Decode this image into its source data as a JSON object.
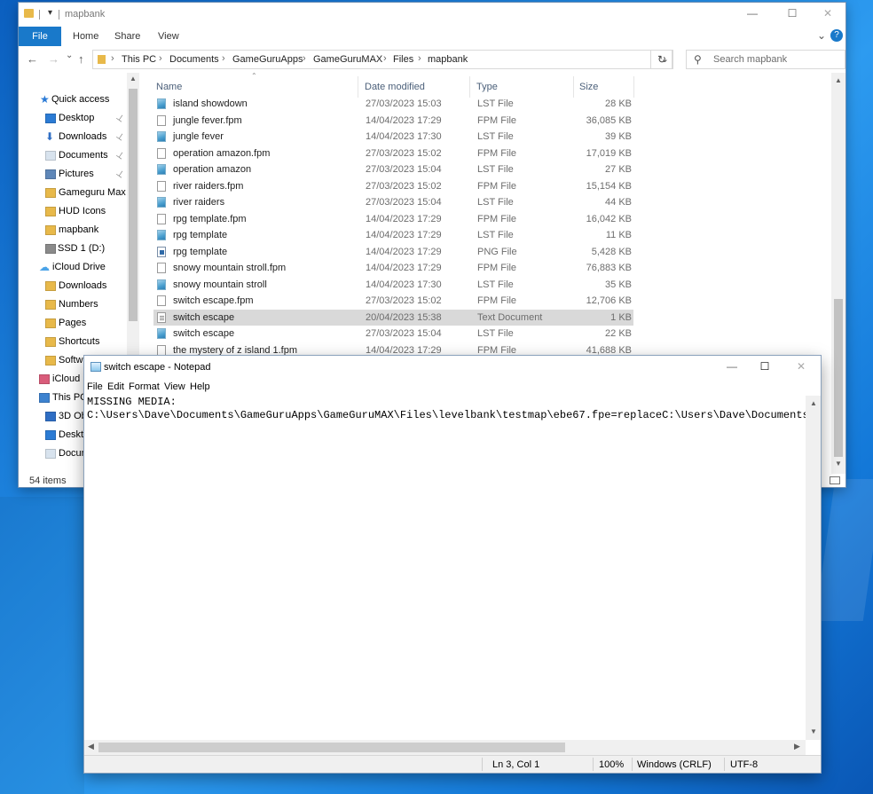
{
  "explorer": {
    "title": "mapbank",
    "window_controls": {
      "minimize": "—",
      "maximize": "☐",
      "close": "✕"
    },
    "ribbon": {
      "file": "File",
      "tabs": [
        "Home",
        "Share",
        "View"
      ],
      "help": "?"
    },
    "nav_buttons": {
      "back": "←",
      "forward": "→",
      "recent": "⌄",
      "up": "↑"
    },
    "breadcrumb": [
      "This PC",
      "Documents",
      "GameGuruApps",
      "GameGuruMAX",
      "Files",
      "mapbank"
    ],
    "search_placeholder": "Search mapbank",
    "columns": {
      "name": "Name",
      "date": "Date modified",
      "type": "Type",
      "size": "Size"
    },
    "nav_items": [
      {
        "label": "Quick access",
        "icon": "star-icon",
        "pinned": false
      },
      {
        "label": "Desktop",
        "icon": "desktop-icon",
        "pinned": true
      },
      {
        "label": "Downloads",
        "icon": "download-icon",
        "pinned": true
      },
      {
        "label": "Documents",
        "icon": "documents-icon",
        "pinned": true
      },
      {
        "label": "Pictures",
        "icon": "pictures-icon",
        "pinned": true
      },
      {
        "label": "Gameguru Max",
        "icon": "folder-icon",
        "pinned": false
      },
      {
        "label": "HUD Icons",
        "icon": "folder-icon",
        "pinned": false
      },
      {
        "label": "mapbank",
        "icon": "folder-icon",
        "pinned": false
      },
      {
        "label": "SSD 1 (D:)",
        "icon": "drive-icon",
        "pinned": false
      },
      {
        "label": "iCloud Drive",
        "icon": "cloud-icon",
        "pinned": false
      },
      {
        "label": "Downloads",
        "icon": "folder-icon",
        "pinned": false
      },
      {
        "label": "Numbers",
        "icon": "folder-icon",
        "pinned": false
      },
      {
        "label": "Pages",
        "icon": "folder-icon",
        "pinned": false
      },
      {
        "label": "Shortcuts",
        "icon": "folder-icon",
        "pinned": false
      },
      {
        "label": "Softwa",
        "icon": "folder-icon",
        "pinned": false
      },
      {
        "label": "iCloud P",
        "icon": "photos-icon",
        "pinned": false
      },
      {
        "label": "This PC",
        "icon": "computer-icon",
        "pinned": false
      },
      {
        "label": "3D Ob",
        "icon": "3d-objects-icon",
        "pinned": false
      },
      {
        "label": "Deskto",
        "icon": "desktop-icon",
        "pinned": false
      },
      {
        "label": "Docun",
        "icon": "documents-icon",
        "pinned": false
      }
    ],
    "pin_glyph": "📌",
    "files": [
      {
        "name": "island showdown",
        "date": "27/03/2023 15:03",
        "type": "LST File",
        "size": "28 KB",
        "icon": "lst"
      },
      {
        "name": "jungle fever.fpm",
        "date": "14/04/2023 17:29",
        "type": "FPM File",
        "size": "36,085 KB",
        "icon": "fpm"
      },
      {
        "name": "jungle fever",
        "date": "14/04/2023 17:30",
        "type": "LST File",
        "size": "39 KB",
        "icon": "lst"
      },
      {
        "name": "operation amazon.fpm",
        "date": "27/03/2023 15:02",
        "type": "FPM File",
        "size": "17,019 KB",
        "icon": "fpm"
      },
      {
        "name": "operation amazon",
        "date": "27/03/2023 15:04",
        "type": "LST File",
        "size": "27 KB",
        "icon": "lst"
      },
      {
        "name": "river raiders.fpm",
        "date": "27/03/2023 15:02",
        "type": "FPM File",
        "size": "15,154 KB",
        "icon": "fpm"
      },
      {
        "name": "river raiders",
        "date": "27/03/2023 15:04",
        "type": "LST File",
        "size": "44 KB",
        "icon": "lst"
      },
      {
        "name": "rpg template.fpm",
        "date": "14/04/2023 17:29",
        "type": "FPM File",
        "size": "16,042 KB",
        "icon": "fpm"
      },
      {
        "name": "rpg template",
        "date": "14/04/2023 17:29",
        "type": "LST File",
        "size": "11 KB",
        "icon": "lst"
      },
      {
        "name": "rpg template",
        "date": "14/04/2023 17:29",
        "type": "PNG File",
        "size": "5,428 KB",
        "icon": "png"
      },
      {
        "name": "snowy mountain stroll.fpm",
        "date": "14/04/2023 17:29",
        "type": "FPM File",
        "size": "76,883 KB",
        "icon": "fpm"
      },
      {
        "name": "snowy mountain stroll",
        "date": "14/04/2023 17:30",
        "type": "LST File",
        "size": "35 KB",
        "icon": "lst"
      },
      {
        "name": "switch escape.fpm",
        "date": "27/03/2023 15:02",
        "type": "FPM File",
        "size": "12,706 KB",
        "icon": "fpm"
      },
      {
        "name": "switch escape",
        "date": "20/04/2023 15:38",
        "type": "Text Document",
        "size": "1 KB",
        "icon": "txt",
        "selected": true
      },
      {
        "name": "switch escape",
        "date": "27/03/2023 15:04",
        "type": "LST File",
        "size": "22 KB",
        "icon": "lst"
      },
      {
        "name": "the mystery of z island 1.fpm",
        "date": "14/04/2023 17:29",
        "type": "FPM File",
        "size": "41,688 KB",
        "icon": "fpm"
      }
    ],
    "status": {
      "items_count": "54 items"
    }
  },
  "notepad": {
    "title": "switch escape - Notepad",
    "window_controls": {
      "minimize": "—",
      "maximize": "☐",
      "close": "✕"
    },
    "menu": [
      "File",
      "Edit",
      "Format",
      "View",
      "Help"
    ],
    "content": "MISSING MEDIA:\nC:\\Users\\Dave\\Documents\\GameGuruApps\\GameGuruMAX\\Files\\levelbank\\testmap\\ebe67.fpe=replaceC:\\Users\\Dave\\Documents\\Ga",
    "status": {
      "position": "Ln 3, Col 1",
      "zoom": "100%",
      "line_ending": "Windows (CRLF)",
      "encoding": "UTF-8"
    }
  }
}
